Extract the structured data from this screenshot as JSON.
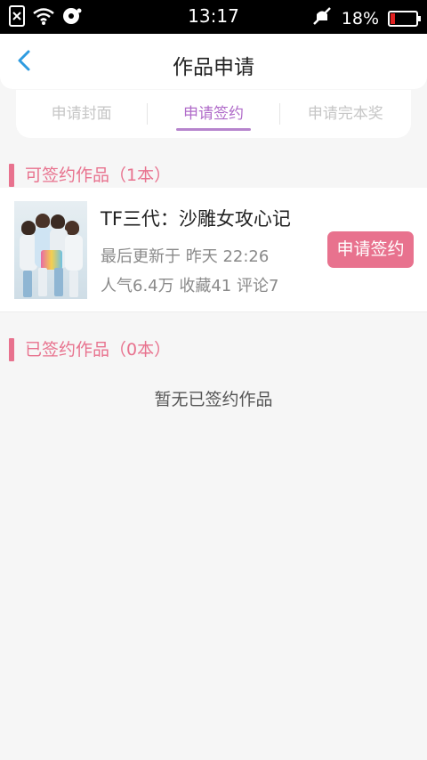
{
  "statusbar": {
    "time": "13:17",
    "battery": "18%",
    "battery_level": 0.18
  },
  "header": {
    "title": "作品申请"
  },
  "tabs": [
    {
      "label": "申请封面",
      "active": false
    },
    {
      "label": "申请签约",
      "active": true
    },
    {
      "label": "申请完本奖",
      "active": false
    }
  ],
  "signable": {
    "heading": "可签约作品（1本）",
    "work": {
      "title": "TF三代：沙雕女攻心记",
      "updated": "最后更新于 昨天 22:26",
      "stats": "人气6.4万 收藏41 评论7",
      "apply_label": "申请签约"
    }
  },
  "signed": {
    "heading": "已签约作品（0本）",
    "empty_text": "暂无已签约作品"
  },
  "colors": {
    "accent": "#e8728e",
    "tab_active": "#b06bc9"
  }
}
